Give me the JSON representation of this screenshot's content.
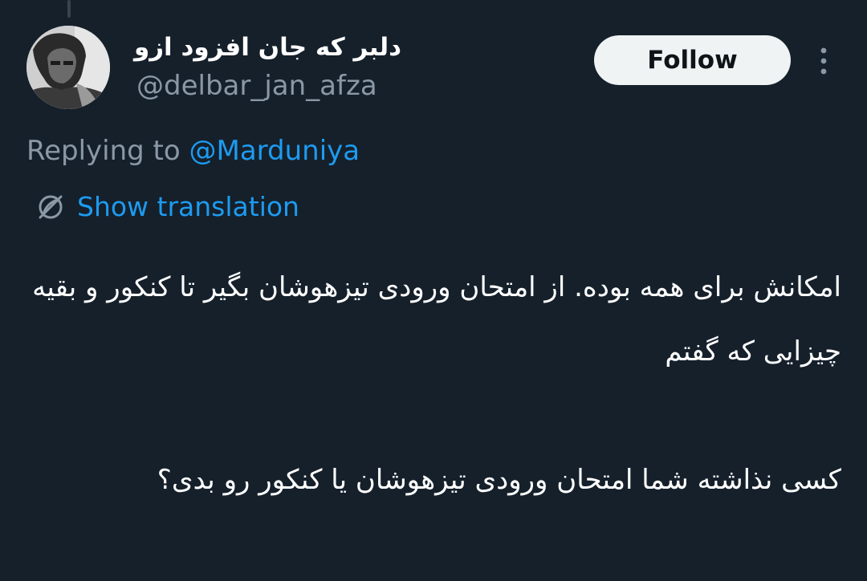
{
  "author": {
    "display_name": "دلبر که جان افزود ازو",
    "username": "@delbar_jan_afza",
    "avatar_icon": "avatar-photo"
  },
  "actions": {
    "follow_label": "Follow",
    "more_icon": "more-vertical-icon"
  },
  "reply": {
    "prefix": "Replying to ",
    "mention": "@Marduniya"
  },
  "translation": {
    "icon": "globe-icon",
    "label": "Show translation"
  },
  "tweet": {
    "paragraph_1": "امکانش برای همه بوده. از امتحان ورودی تیزهوشان بگیر تا کنکور و بقیه چیزایی که گفتم",
    "paragraph_2": "کسی نذاشته شما امتحان ورودی تیزهوشان یا کنکور رو بدی؟"
  },
  "colors": {
    "background": "#15202b",
    "text_primary": "#ffffff",
    "text_secondary": "#8b98a5",
    "accent": "#1d9bf0",
    "follow_bg": "#eff3f4"
  }
}
